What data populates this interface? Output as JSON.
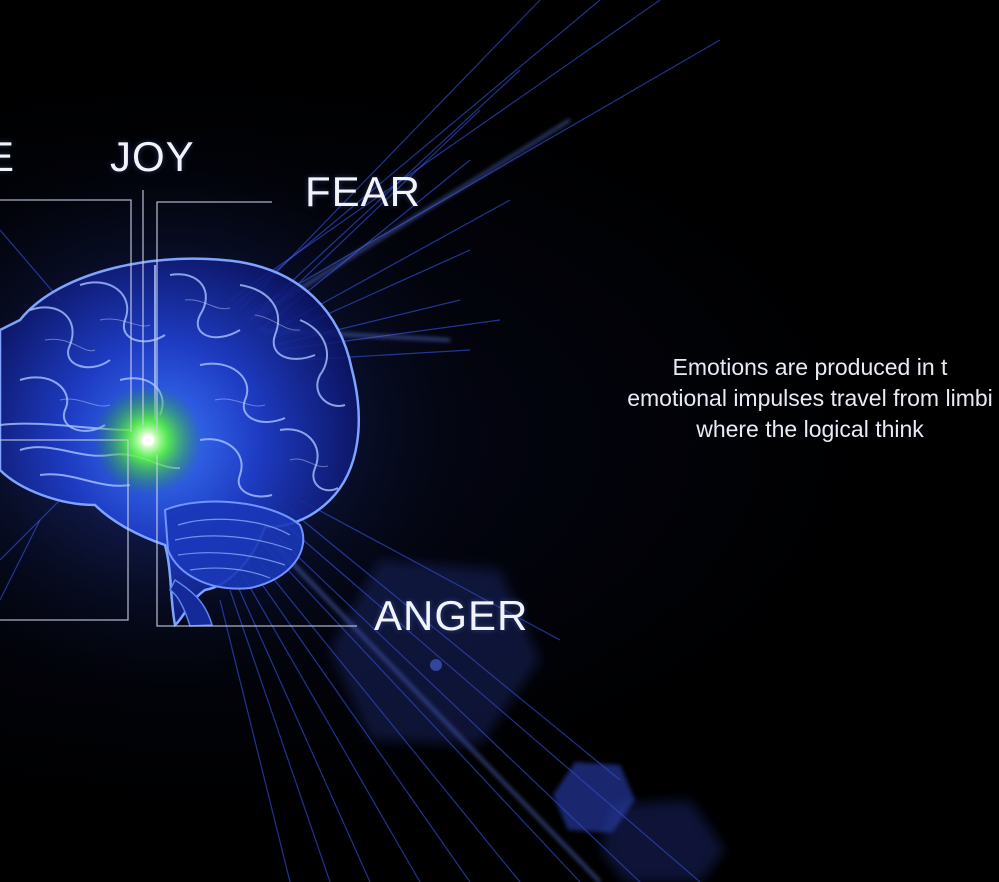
{
  "labels": {
    "joy": "JOY",
    "fear": "FEAR",
    "anger": "ANGER",
    "cut_off": "E"
  },
  "description": {
    "line1": "Emotions are produced in t",
    "line2": "emotional impulses travel from limbi",
    "line3": "where the logical think"
  },
  "colors": {
    "background": "#000000",
    "brain_glow": "#2a5cff",
    "limbic_highlight": "#5dff3a",
    "text": "#f2f4fa",
    "leader_lines": "#c9d0e6"
  },
  "icons": {
    "brain": "brain-illustration",
    "limbic": "limbic-glow"
  }
}
